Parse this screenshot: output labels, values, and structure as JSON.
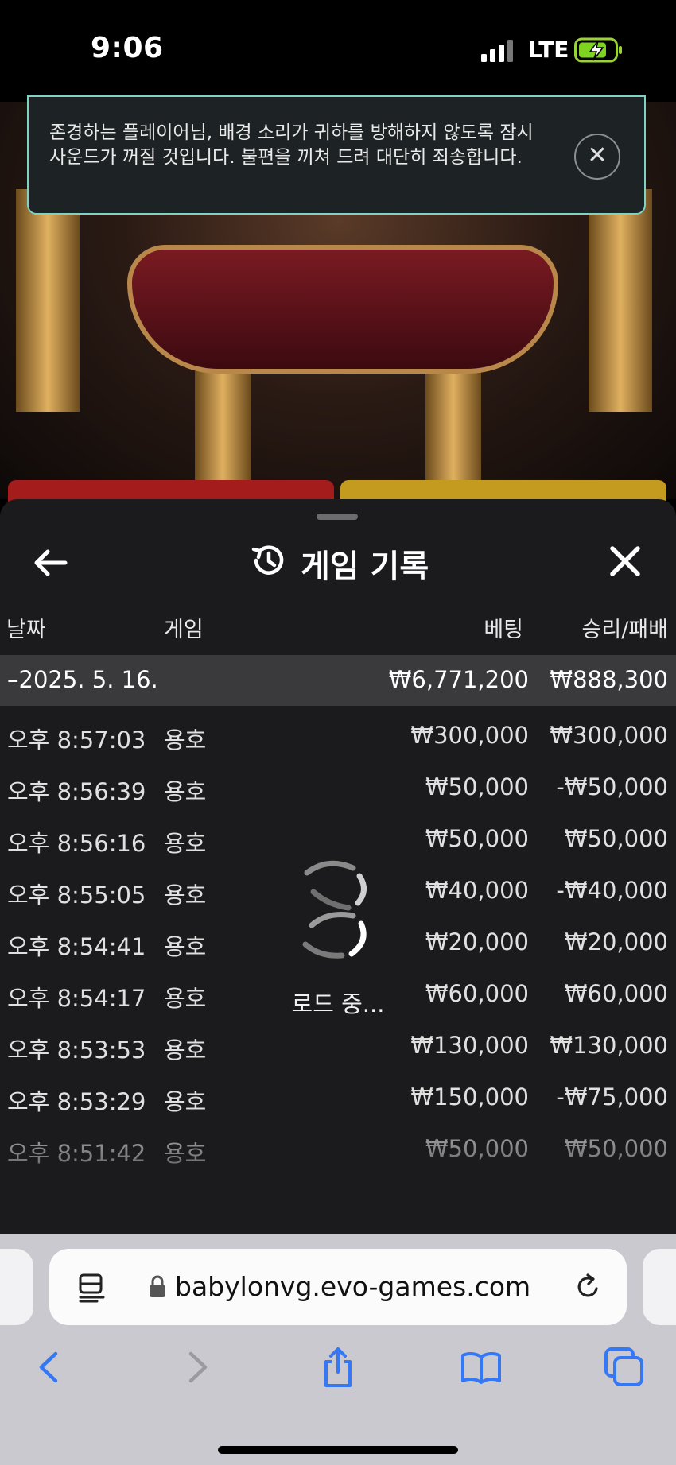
{
  "status": {
    "time": "9:06",
    "network": "LTE"
  },
  "notice": {
    "text": "존경하는 플레이어님, 배경 소리가 귀하를 방해하지 않도록 잠시 사운드가 꺼질 것입니다. 불편을 끼쳐 드려 대단히 죄송합니다.",
    "close_glyph": "✕"
  },
  "panel": {
    "title": "게임 기록",
    "headers": {
      "date": "날짜",
      "game": "게임",
      "bet": "베팅",
      "winloss": "승리/패배"
    },
    "date_group": {
      "date": "–2025. 5. 16.",
      "bet_total": "₩6,771,200",
      "winloss_total": "₩888,300"
    },
    "rows": [
      {
        "time": "오후 8:57:03",
        "game": "용호",
        "bet": "₩300,000",
        "winloss": "₩300,000"
      },
      {
        "time": "오후 8:56:39",
        "game": "용호",
        "bet": "₩50,000",
        "winloss": "-₩50,000"
      },
      {
        "time": "오후 8:56:16",
        "game": "용호",
        "bet": "₩50,000",
        "winloss": "₩50,000"
      },
      {
        "time": "오후 8:55:05",
        "game": "용호",
        "bet": "₩40,000",
        "winloss": "-₩40,000"
      },
      {
        "time": "오후 8:54:41",
        "game": "용호",
        "bet": "₩20,000",
        "winloss": "₩20,000"
      },
      {
        "time": "오후 8:54:17",
        "game": "용호",
        "bet": "₩60,000",
        "winloss": "₩60,000"
      },
      {
        "time": "오후 8:53:53",
        "game": "용호",
        "bet": "₩130,000",
        "winloss": "₩130,000"
      },
      {
        "time": "오후 8:53:29",
        "game": "용호",
        "bet": "₩150,000",
        "winloss": "-₩75,000"
      },
      {
        "time": "오후 8:51:42",
        "game": "용호",
        "bet": "₩50,000",
        "winloss": "₩50,000"
      }
    ],
    "loading_text": "로드 중..."
  },
  "browser": {
    "url": "babylonvg.evo-games.com",
    "accent": "#3478f6"
  }
}
